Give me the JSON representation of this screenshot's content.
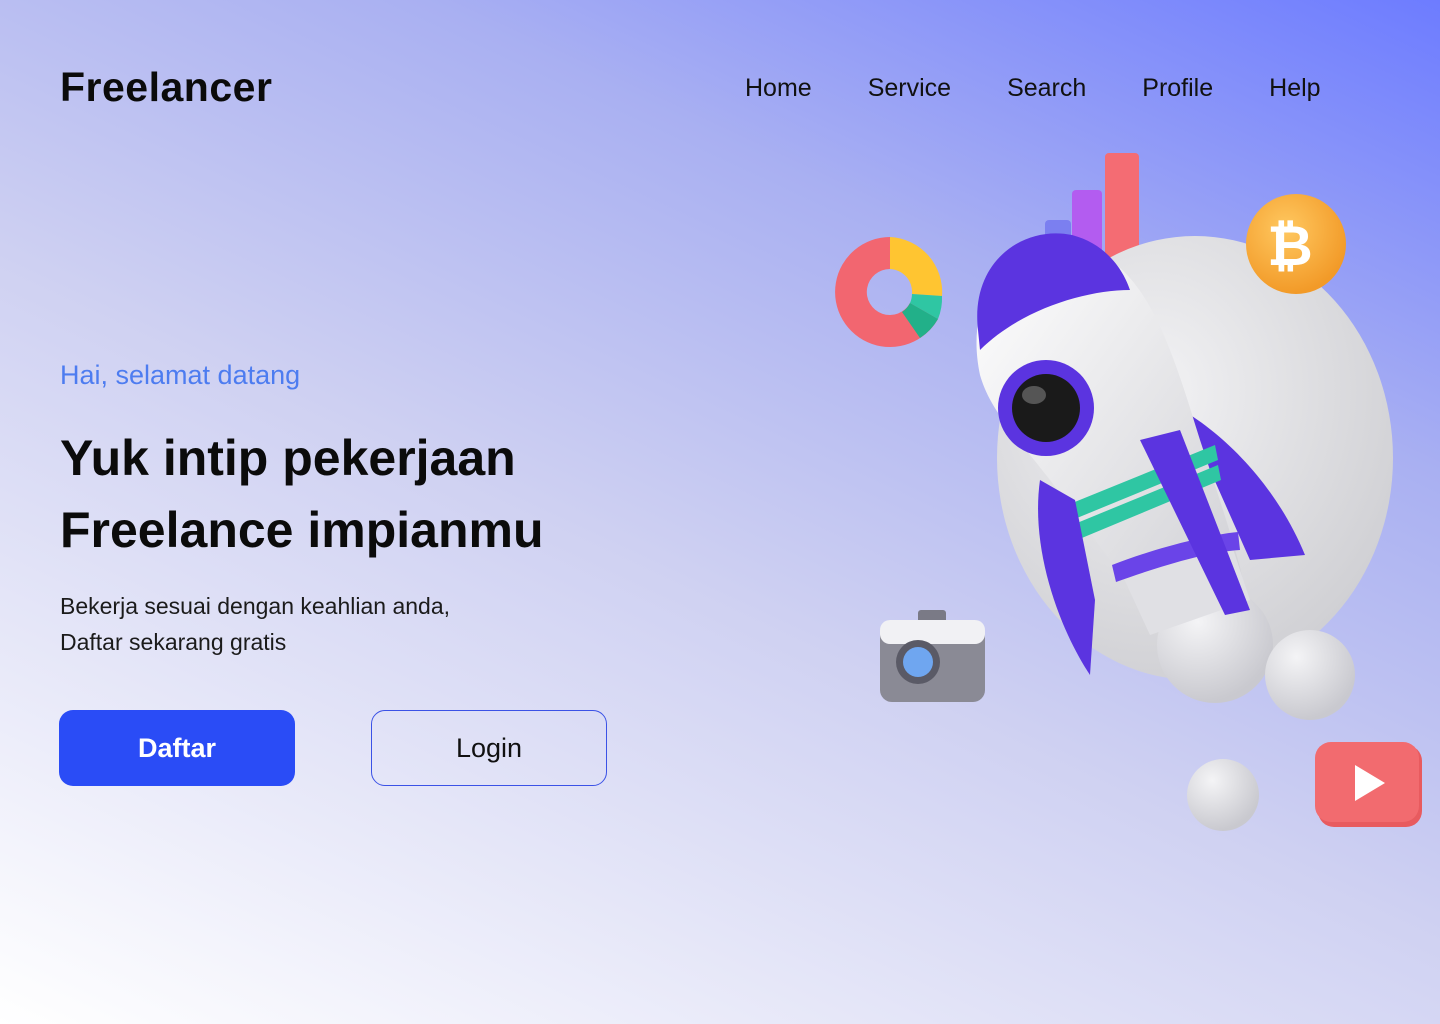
{
  "header": {
    "brand": "Freelancer",
    "nav": [
      "Home",
      "Service",
      "Search",
      "Profile",
      "Help"
    ]
  },
  "hero": {
    "greeting": "Hai, selamat datang",
    "headline": [
      "Yuk intip pekerjaan",
      "Freelance impianmu"
    ],
    "description": [
      "Bekerja sesuai dengan keahlian anda,",
      "Daftar sekarang gratis"
    ],
    "primary_button": "Daftar",
    "secondary_button": "Login"
  },
  "illustration": {
    "items": [
      "rocket-icon",
      "pie-chart-icon",
      "bar-chart-icon",
      "bitcoin-icon",
      "camera-icon",
      "play-button-icon",
      "sphere-decoration"
    ]
  },
  "colors": {
    "accent": "#2a4cf6",
    "greeting": "#4d7cf0",
    "rocket_purple": "#5b34e0",
    "gradient_start": "#6d7cff",
    "gradient_end": "#ffffff"
  }
}
